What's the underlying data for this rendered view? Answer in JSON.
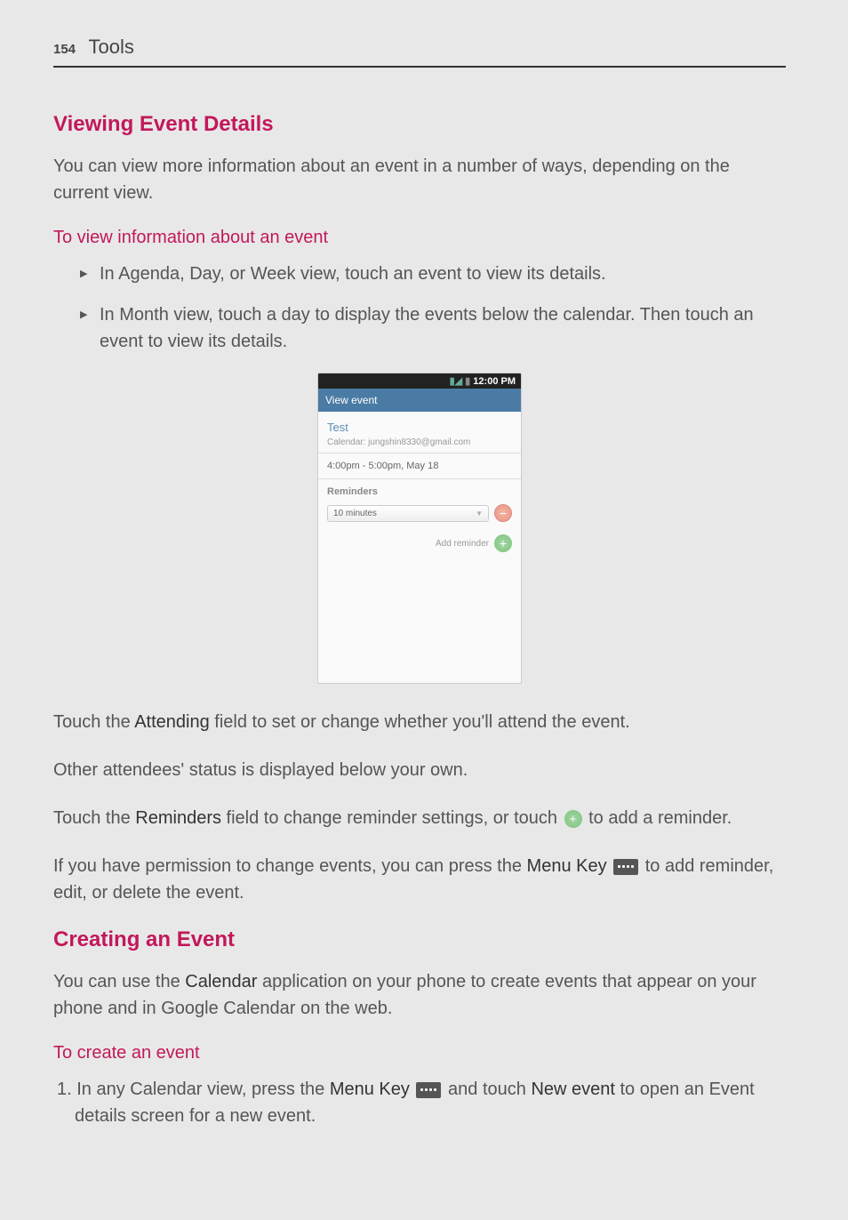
{
  "header": {
    "pageNum": "154",
    "title": "Tools"
  },
  "section1": {
    "heading": "Viewing Event Details",
    "intro": "You can view more information about an event in a number of ways, depending on the current view.",
    "subheading": "To view information about an event",
    "bullet1": "In Agenda, Day, or Week view, touch an event to view its details.",
    "bullet2": "In Month view, touch a day to display the events below the calendar. Then touch an event to view its details."
  },
  "screenshot": {
    "statusTime": "12:00 PM",
    "titleBar": "View event",
    "eventName": "Test",
    "calendarLine": "Calendar: jungshin8330@gmail.com",
    "timeLine": "4:00pm - 5:00pm, May 18",
    "remindersLabel": "Reminders",
    "reminderValue": "10 minutes",
    "addReminderLabel": "Add reminder"
  },
  "para1_a": "Touch the ",
  "para1_b": "Attending",
  "para1_c": " field to set or change whether you'll attend the event.",
  "para2": "Other attendees' status is displayed below your own.",
  "para3_a": "Touch the ",
  "para3_b": "Reminders",
  "para3_c": " field to change reminder settings, or touch ",
  "para3_d": " to add a reminder.",
  "para4_a": "If you have permission to change events, you can press the ",
  "para4_b": "Menu Key",
  "para4_c": " to add reminder, edit, or delete the event.",
  "section2": {
    "heading": "Creating an Event",
    "intro_a": "You can use the ",
    "intro_b": "Calendar",
    "intro_c": " application on your phone to create events that appear on your phone and in Google Calendar on the web.",
    "subheading": "To create an event",
    "step1_a": "1. In any Calendar view, press the ",
    "step1_b": "Menu Key",
    "step1_c": " and touch ",
    "step1_d": "New event",
    "step1_e": " to open an Event details screen for a new event."
  }
}
